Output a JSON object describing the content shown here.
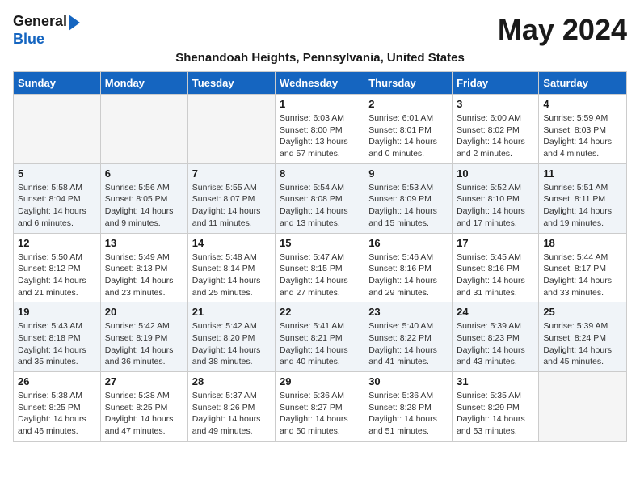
{
  "header": {
    "logo_line1": "General",
    "logo_line2": "Blue",
    "month_year": "May 2024",
    "location": "Shenandoah Heights, Pennsylvania, United States"
  },
  "days_of_week": [
    "Sunday",
    "Monday",
    "Tuesday",
    "Wednesday",
    "Thursday",
    "Friday",
    "Saturday"
  ],
  "weeks": [
    [
      {
        "day": "",
        "info": ""
      },
      {
        "day": "",
        "info": ""
      },
      {
        "day": "",
        "info": ""
      },
      {
        "day": "1",
        "info": "Sunrise: 6:03 AM\nSunset: 8:00 PM\nDaylight: 13 hours\nand 57 minutes."
      },
      {
        "day": "2",
        "info": "Sunrise: 6:01 AM\nSunset: 8:01 PM\nDaylight: 14 hours\nand 0 minutes."
      },
      {
        "day": "3",
        "info": "Sunrise: 6:00 AM\nSunset: 8:02 PM\nDaylight: 14 hours\nand 2 minutes."
      },
      {
        "day": "4",
        "info": "Sunrise: 5:59 AM\nSunset: 8:03 PM\nDaylight: 14 hours\nand 4 minutes."
      }
    ],
    [
      {
        "day": "5",
        "info": "Sunrise: 5:58 AM\nSunset: 8:04 PM\nDaylight: 14 hours\nand 6 minutes."
      },
      {
        "day": "6",
        "info": "Sunrise: 5:56 AM\nSunset: 8:05 PM\nDaylight: 14 hours\nand 9 minutes."
      },
      {
        "day": "7",
        "info": "Sunrise: 5:55 AM\nSunset: 8:07 PM\nDaylight: 14 hours\nand 11 minutes."
      },
      {
        "day": "8",
        "info": "Sunrise: 5:54 AM\nSunset: 8:08 PM\nDaylight: 14 hours\nand 13 minutes."
      },
      {
        "day": "9",
        "info": "Sunrise: 5:53 AM\nSunset: 8:09 PM\nDaylight: 14 hours\nand 15 minutes."
      },
      {
        "day": "10",
        "info": "Sunrise: 5:52 AM\nSunset: 8:10 PM\nDaylight: 14 hours\nand 17 minutes."
      },
      {
        "day": "11",
        "info": "Sunrise: 5:51 AM\nSunset: 8:11 PM\nDaylight: 14 hours\nand 19 minutes."
      }
    ],
    [
      {
        "day": "12",
        "info": "Sunrise: 5:50 AM\nSunset: 8:12 PM\nDaylight: 14 hours\nand 21 minutes."
      },
      {
        "day": "13",
        "info": "Sunrise: 5:49 AM\nSunset: 8:13 PM\nDaylight: 14 hours\nand 23 minutes."
      },
      {
        "day": "14",
        "info": "Sunrise: 5:48 AM\nSunset: 8:14 PM\nDaylight: 14 hours\nand 25 minutes."
      },
      {
        "day": "15",
        "info": "Sunrise: 5:47 AM\nSunset: 8:15 PM\nDaylight: 14 hours\nand 27 minutes."
      },
      {
        "day": "16",
        "info": "Sunrise: 5:46 AM\nSunset: 8:16 PM\nDaylight: 14 hours\nand 29 minutes."
      },
      {
        "day": "17",
        "info": "Sunrise: 5:45 AM\nSunset: 8:16 PM\nDaylight: 14 hours\nand 31 minutes."
      },
      {
        "day": "18",
        "info": "Sunrise: 5:44 AM\nSunset: 8:17 PM\nDaylight: 14 hours\nand 33 minutes."
      }
    ],
    [
      {
        "day": "19",
        "info": "Sunrise: 5:43 AM\nSunset: 8:18 PM\nDaylight: 14 hours\nand 35 minutes."
      },
      {
        "day": "20",
        "info": "Sunrise: 5:42 AM\nSunset: 8:19 PM\nDaylight: 14 hours\nand 36 minutes."
      },
      {
        "day": "21",
        "info": "Sunrise: 5:42 AM\nSunset: 8:20 PM\nDaylight: 14 hours\nand 38 minutes."
      },
      {
        "day": "22",
        "info": "Sunrise: 5:41 AM\nSunset: 8:21 PM\nDaylight: 14 hours\nand 40 minutes."
      },
      {
        "day": "23",
        "info": "Sunrise: 5:40 AM\nSunset: 8:22 PM\nDaylight: 14 hours\nand 41 minutes."
      },
      {
        "day": "24",
        "info": "Sunrise: 5:39 AM\nSunset: 8:23 PM\nDaylight: 14 hours\nand 43 minutes."
      },
      {
        "day": "25",
        "info": "Sunrise: 5:39 AM\nSunset: 8:24 PM\nDaylight: 14 hours\nand 45 minutes."
      }
    ],
    [
      {
        "day": "26",
        "info": "Sunrise: 5:38 AM\nSunset: 8:25 PM\nDaylight: 14 hours\nand 46 minutes."
      },
      {
        "day": "27",
        "info": "Sunrise: 5:38 AM\nSunset: 8:25 PM\nDaylight: 14 hours\nand 47 minutes."
      },
      {
        "day": "28",
        "info": "Sunrise: 5:37 AM\nSunset: 8:26 PM\nDaylight: 14 hours\nand 49 minutes."
      },
      {
        "day": "29",
        "info": "Sunrise: 5:36 AM\nSunset: 8:27 PM\nDaylight: 14 hours\nand 50 minutes."
      },
      {
        "day": "30",
        "info": "Sunrise: 5:36 AM\nSunset: 8:28 PM\nDaylight: 14 hours\nand 51 minutes."
      },
      {
        "day": "31",
        "info": "Sunrise: 5:35 AM\nSunset: 8:29 PM\nDaylight: 14 hours\nand 53 minutes."
      },
      {
        "day": "",
        "info": ""
      }
    ]
  ]
}
